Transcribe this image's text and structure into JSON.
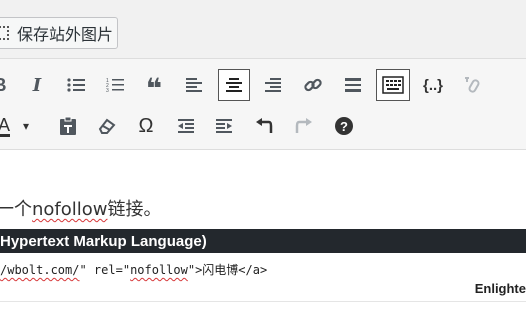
{
  "header": {
    "save_images_label": "保存站外图片"
  },
  "toolbar": {
    "row1": [
      {
        "name": "bold-icon",
        "glyph": "B"
      },
      {
        "name": "italic-icon",
        "glyph": "I"
      },
      {
        "name": "bulleted-list-icon"
      },
      {
        "name": "numbered-list-icon"
      },
      {
        "name": "blockquote-icon",
        "glyph": "❝"
      },
      {
        "name": "align-left-icon"
      },
      {
        "name": "align-center-icon",
        "active": true
      },
      {
        "name": "align-right-icon"
      },
      {
        "name": "insert-link-icon"
      },
      {
        "name": "read-more-icon"
      },
      {
        "name": "toolbar-toggle-icon",
        "active": true
      },
      {
        "name": "code-icon",
        "glyph": "{..}"
      },
      {
        "name": "remove-link-icon",
        "disabled": true
      }
    ],
    "row2": [
      {
        "name": "text-color-icon",
        "glyph": "A"
      },
      {
        "name": "dropdown-caret-icon",
        "glyph": "▾"
      },
      {
        "name": "paste-as-text-icon"
      },
      {
        "name": "clear-formatting-icon"
      },
      {
        "name": "special-character-icon",
        "glyph": "Ω"
      },
      {
        "name": "outdent-icon"
      },
      {
        "name": "indent-icon"
      },
      {
        "name": "undo-icon",
        "glyph": "↶"
      },
      {
        "name": "redo-icon",
        "glyph": "↷",
        "disabled": true
      },
      {
        "name": "help-icon",
        "glyph": "?"
      }
    ]
  },
  "editor": {
    "para_prefix": "一个",
    "para_link": "nofollow",
    "para_suffix": "链接。",
    "code_title": "Hypertext Markup Language)",
    "code_a": "/wbolt.com/",
    "code_b": "\" rel=\"",
    "code_c": "nofollow",
    "code_d": "\">闪电博</a>",
    "brand": "Enlighte"
  },
  "colors": {
    "code_header_bg": "#23282d",
    "spell_underline": "#d63638"
  }
}
